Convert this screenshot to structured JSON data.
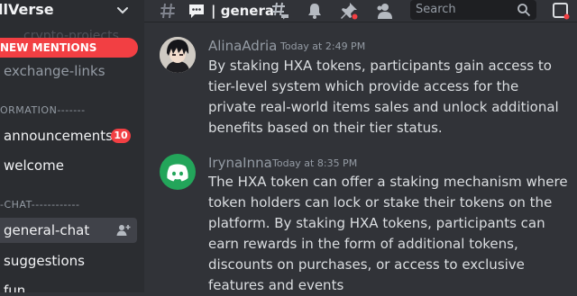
{
  "sidebar": {
    "server_name": "llVerse",
    "ghost_channel": "crypto-projects",
    "new_mentions": "NEW MENTIONS",
    "channels": [
      {
        "label": "exchange-links"
      },
      {
        "label": "announcements",
        "badge": "10"
      },
      {
        "label": "welcome"
      },
      {
        "label": "general-chat"
      },
      {
        "label": "suggestions"
      },
      {
        "label": "fun"
      }
    ],
    "categories": [
      {
        "label": "ORMATION-------"
      },
      {
        "label": "-CHAT------------"
      }
    ]
  },
  "topbar": {
    "title": "| genera",
    "search_placeholder": "Search",
    "icons": [
      "threads-icon",
      "notification-bell-icon",
      "pinned-icon",
      "member-list-icon",
      "inbox-icon"
    ]
  },
  "messages": [
    {
      "author": "AlinaAdria",
      "author_color": "#949ba4",
      "timestamp": "Today at 2:49 PM",
      "text": "By staking HXA tokens, participants gain access to tier-level system which provide access for the private real-world items sales and unlock additional benefits based on their tier status."
    },
    {
      "author": "IrynaInna",
      "author_color": "#949ba4",
      "timestamp": "Today at 8:35 PM",
      "text": "The HXA token can offer a staking mechanism where token holders can lock or stake their tokens on the platform. By staking HXA tokens, participants can earn rewards in the form of additional tokens, discounts on purchases, or access to exclusive features and events"
    }
  ],
  "colors": {
    "accent_red": "#f23f43",
    "discord_green": "#23a55a",
    "background": "#313338",
    "sidebar": "#2b2d31"
  }
}
